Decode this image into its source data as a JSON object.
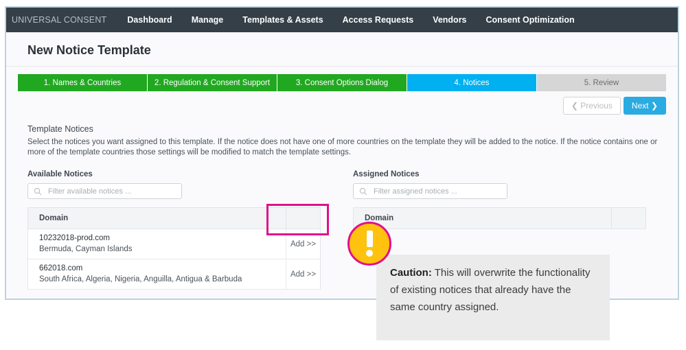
{
  "nav": {
    "brand": "UNIVERSAL CONSENT",
    "items": [
      {
        "label": "Dashboard"
      },
      {
        "label": "Manage"
      },
      {
        "label": "Templates & Assets"
      },
      {
        "label": "Access Requests"
      },
      {
        "label": "Vendors"
      },
      {
        "label": "Consent Optimization"
      }
    ]
  },
  "page": {
    "title": "New Notice Template"
  },
  "wizard": {
    "steps": [
      {
        "label": "1. Names & Countries",
        "state": "done"
      },
      {
        "label": "2. Regulation & Consent Support",
        "state": "done"
      },
      {
        "label": "3. Consent Options Dialog",
        "state": "done"
      },
      {
        "label": "4. Notices",
        "state": "active"
      },
      {
        "label": "5. Review",
        "state": "todo"
      }
    ]
  },
  "buttons": {
    "previous": "Previous",
    "next": "Next",
    "previous_icon": "chevron-left-icon",
    "next_icon": "chevron-right-icon"
  },
  "section": {
    "title": "Template Notices",
    "description": "Select the notices you want assigned to this template. If the notice does not have one of more countries on the template they will be added to the notice. If the notice contains one or more of the template countries those settings will be modified to match the template settings."
  },
  "available": {
    "label": "Available Notices",
    "search_placeholder": "Filter available notices ...",
    "search_value": "",
    "column_header": "Domain",
    "rows": [
      {
        "domain": "10232018-prod.com",
        "countries": "Bermuda, Cayman Islands",
        "action": "Add >>"
      },
      {
        "domain": "662018.com",
        "countries": "South Africa, Algeria, Nigeria, Anguilla, Antigua & Barbuda",
        "action": "Add >>"
      }
    ]
  },
  "assigned": {
    "label": "Assigned Notices",
    "search_placeholder": "Filter assigned notices ...",
    "search_value": "",
    "column_header": "Domain",
    "rows": []
  },
  "caution": {
    "prefix": "Caution:",
    "text": " This will overwrite the functionality of existing notices that already have the same country assigned.",
    "icon": "exclamation-circle-icon"
  },
  "colors": {
    "nav_bg": "#343f48",
    "step_done": "#21a821",
    "step_active": "#00b0f0",
    "step_todo": "#d6d6d6",
    "next_button": "#2aabe2",
    "highlight": "#e0108c",
    "warning_fill": "#ffc20e",
    "caution_bg": "#ebebeb"
  }
}
